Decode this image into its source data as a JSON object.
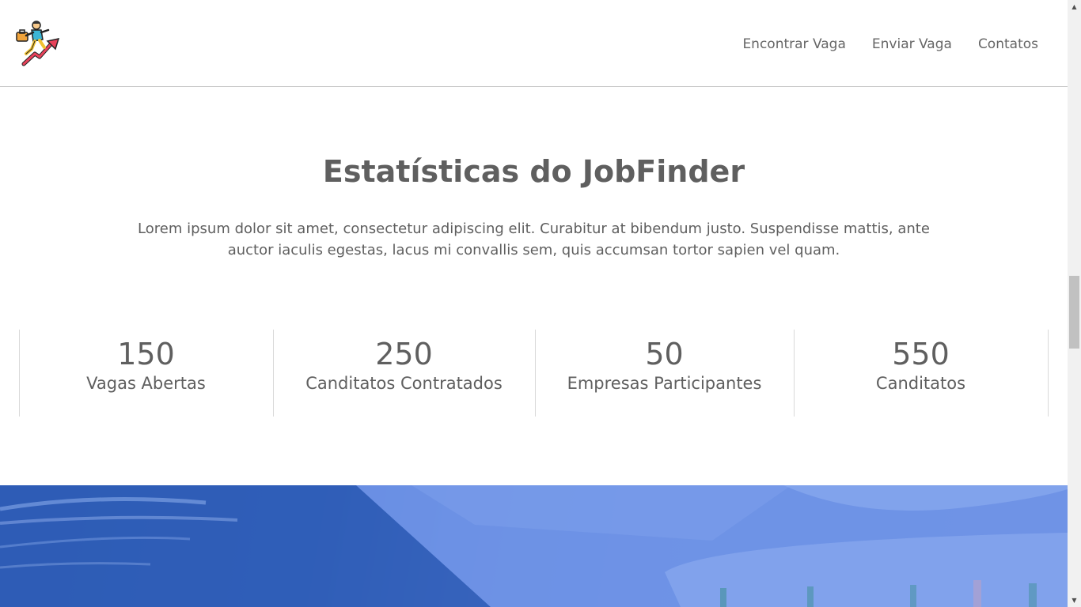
{
  "header": {
    "logo_icon": "job-climber-logo-icon",
    "nav": [
      {
        "label": "Encontrar Vaga"
      },
      {
        "label": "Enviar Vaga"
      },
      {
        "label": "Contatos"
      }
    ]
  },
  "stats_section": {
    "title": "Estatísticas do JobFinder",
    "description": "Lorem ipsum dolor sit amet, consectetur adipiscing elit. Curabitur at bibendum justo. Suspendisse mattis, ante auctor iaculis egestas, lacus mi convallis sem, quis accumsan tortor sapien vel quam.",
    "items": [
      {
        "value": "150",
        "label": "Vagas Abertas"
      },
      {
        "value": "250",
        "label": "Canditatos Contratados"
      },
      {
        "value": "50",
        "label": "Empresas Participantes"
      },
      {
        "value": "550",
        "label": "Canditatos"
      }
    ]
  },
  "colors": {
    "text": "#5f5f5f",
    "hero_blue": "#3b6cc8",
    "divider": "#d9d9d9"
  },
  "scrollbar": {
    "up_icon": "scroll-up-arrow-icon",
    "down_icon": "scroll-down-arrow-icon"
  }
}
